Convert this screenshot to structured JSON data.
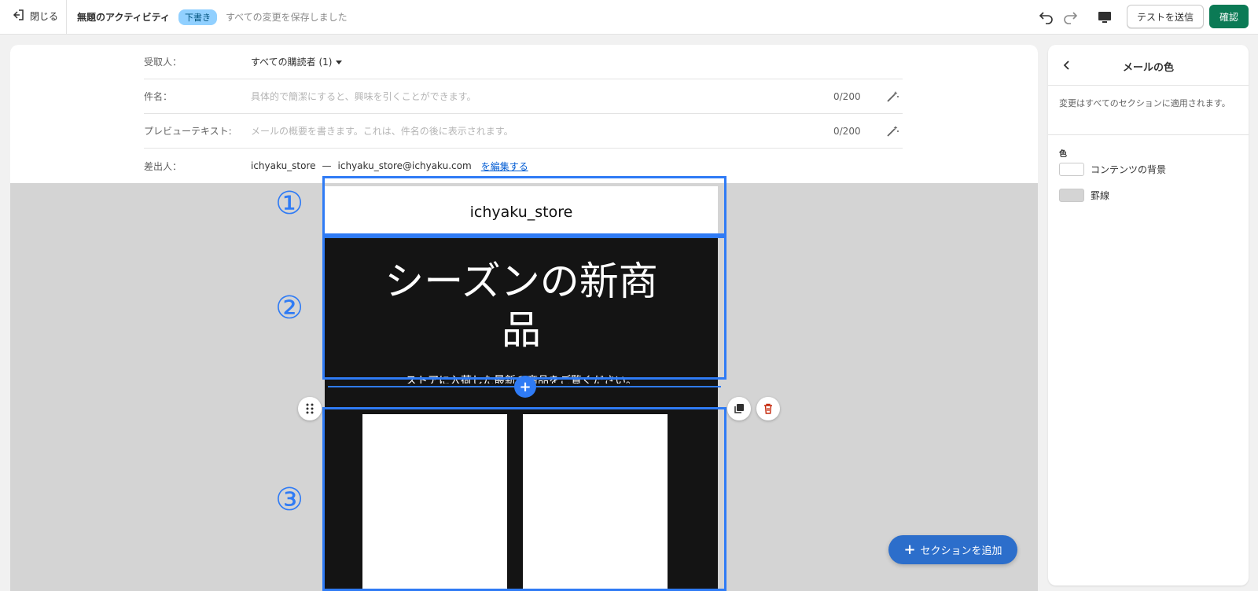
{
  "topbar": {
    "close_label": "閉じる",
    "title": "無題のアクティビティ",
    "draft_badge": "下書き",
    "save_status": "すべての変更を保存しました",
    "test_send_label": "テストを送信",
    "confirm_label": "確認"
  },
  "fields": {
    "recipient": {
      "label": "受取人：",
      "value": "すべての購読者 (1)"
    },
    "subject": {
      "label": "件名：",
      "placeholder": "具体的で簡潔にすると、興味を引くことができます。",
      "counter": "0/200"
    },
    "preview": {
      "label": "プレビューテキスト:",
      "placeholder": "メールの概要を書きます。これは、件名の後に表示されます。",
      "counter": "0/200"
    },
    "sender": {
      "label": "差出人：",
      "name": "ichyaku_store",
      "separator": "—",
      "email": "ichyaku_store@ichyaku.com",
      "edit_link": "を編集する"
    }
  },
  "email": {
    "store_name": "ichyaku_store",
    "hero_title_line1": "シーズンの新商",
    "hero_title_line2": "品",
    "hero_subtitle": "ストアに入荷した最新の商品をご覧ください。"
  },
  "annotations": [
    "①",
    "②",
    "③"
  ],
  "add_section_label": "セクションを追加",
  "panel": {
    "title": "メールの色",
    "note": "変更はすべてのセクションに適用されます。",
    "color_heading": "色",
    "swatches": [
      {
        "label": "コンテンツの背景",
        "color": "#ffffff"
      },
      {
        "label": "罫線",
        "color": "#d4d4d4"
      }
    ]
  },
  "colors": {
    "accent": "#2f7bf5",
    "primary_button": "#0b7a55",
    "add_button": "#2c6ecb",
    "badge_bg": "#91d0ff"
  }
}
